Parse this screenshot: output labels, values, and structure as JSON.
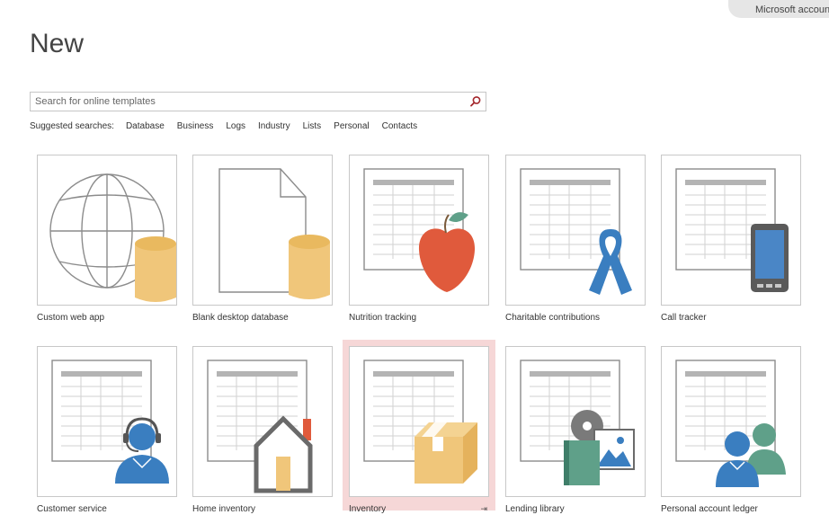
{
  "account": {
    "label": "Microsoft account"
  },
  "page": {
    "title": "New"
  },
  "search": {
    "placeholder": "Search for online templates"
  },
  "suggested": {
    "label": "Suggested searches:",
    "items": [
      "Database",
      "Business",
      "Logs",
      "Industry",
      "Lists",
      "Personal",
      "Contacts"
    ]
  },
  "templates": [
    {
      "label": "Custom web app",
      "icon": "globe-database-icon"
    },
    {
      "label": "Blank desktop database",
      "icon": "blank-document-database-icon"
    },
    {
      "label": "Nutrition tracking",
      "icon": "apple-table-icon"
    },
    {
      "label": "Charitable contributions",
      "icon": "ribbon-table-icon"
    },
    {
      "label": "Call tracker",
      "icon": "phone-table-icon"
    },
    {
      "label": "Customer service",
      "icon": "headset-person-table-icon"
    },
    {
      "label": "Home inventory",
      "icon": "house-table-icon"
    },
    {
      "label": "Inventory",
      "icon": "box-table-icon",
      "selected": true
    },
    {
      "label": "Lending library",
      "icon": "media-table-icon"
    },
    {
      "label": "Personal account ledger",
      "icon": "people-table-icon"
    }
  ],
  "colors": {
    "gold": "#f0c67a",
    "blue": "#3a7ec0",
    "green": "#5fa089",
    "red": "#e05a3c",
    "selection": "#f6d7d7",
    "searchIcon": "#a4262c"
  }
}
